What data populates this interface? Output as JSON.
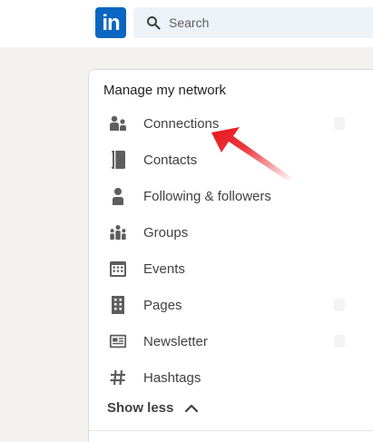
{
  "header": {
    "logo_text": "in",
    "search_placeholder": "Search"
  },
  "network": {
    "title": "Manage my network",
    "items": [
      {
        "label": "Connections",
        "icon": "connections-icon"
      },
      {
        "label": "Contacts",
        "icon": "contacts-icon"
      },
      {
        "label": "Following & followers",
        "icon": "person-icon"
      },
      {
        "label": "Groups",
        "icon": "groups-icon"
      },
      {
        "label": "Events",
        "icon": "calendar-icon"
      },
      {
        "label": "Pages",
        "icon": "building-icon"
      },
      {
        "label": "Newsletter",
        "icon": "newsletter-icon"
      },
      {
        "label": "Hashtags",
        "icon": "hashtag-icon"
      }
    ],
    "show_less_label": "Show less"
  },
  "colors": {
    "brand": "#0a66c2",
    "icon": "#5e5e5e",
    "annotation_arrow": "#e8141c"
  }
}
